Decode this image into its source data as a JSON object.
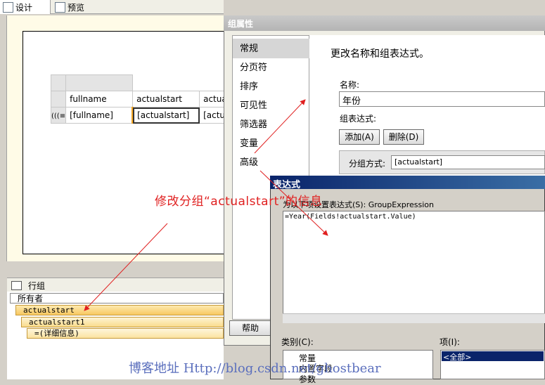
{
  "tabs": [
    {
      "label": "设计"
    },
    {
      "label": "预览"
    }
  ],
  "report_table": {
    "headers": [
      "fullname",
      "actualstart",
      "actua"
    ],
    "row": [
      "[fullname]",
      "[actualstart]",
      "[actua"
    ]
  },
  "row_groups": {
    "title": "行组",
    "items": [
      "所有者",
      "actualstart",
      "actualstart1",
      "=(详细信息)"
    ]
  },
  "group_properties": {
    "title": "组属性",
    "nav": [
      "常规",
      "分页符",
      "排序",
      "可见性",
      "筛选器",
      "变量",
      "高级"
    ],
    "heading": "更改名称和组表达式。",
    "name_label": "名称:",
    "name_value": "年份",
    "expr_label": "组表达式:",
    "add_label": "添加(A)",
    "delete_label": "删除(D)",
    "group_by_label": "分组方式:",
    "group_by_value": "[actualstart]",
    "help_label": "帮助"
  },
  "expression_dialog": {
    "title": "表达式",
    "prompt": "为以下项设置表达式(S): GroupExpression",
    "expression": "=Year(Fields!actualstart.Value)",
    "category_label": "类别(C):",
    "item_label": "项(I):",
    "categories": [
      "常量",
      "内置字段",
      "参数"
    ],
    "items": [
      "<全部>"
    ]
  },
  "annotation": "修改分组“actualstart”的信息",
  "watermark": "博客地址 Http://blog.csdn.net/ghostbear",
  "colors": {
    "annotation": "#e02020",
    "watermark": "#5b6fbd",
    "group_highlight": "#f8c860"
  }
}
